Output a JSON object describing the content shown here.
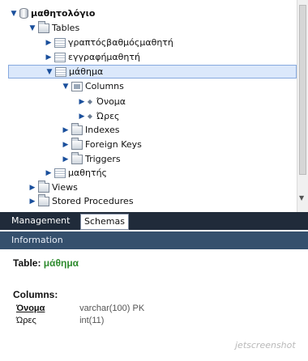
{
  "tree": {
    "database": "μαθητολόγιο",
    "tables_label": "Tables",
    "tables": [
      "γραπτόςβαθμόςμαθητή",
      "εγγραφήμαθητή",
      "μάθημα",
      "μαθητής"
    ],
    "selected_table": "μάθημα",
    "columns_label": "Columns",
    "columns": [
      "Όνομα",
      "Ώρες"
    ],
    "indexes_label": "Indexes",
    "foreign_keys_label": "Foreign Keys",
    "triggers_label": "Triggers",
    "views_label": "Views",
    "stored_procedures_label": "Stored Procedures"
  },
  "tabs": {
    "management": "Management",
    "schemas": "Schemas",
    "active": "Schemas"
  },
  "info": {
    "header": "Information",
    "table_label": "Table:",
    "table_name": "μάθημα",
    "columns_label": "Columns:",
    "columns": [
      {
        "name": "Όνομα",
        "type": "varchar(100) PK",
        "primary_key": true
      },
      {
        "name": "Ώρες",
        "type": "int(11)",
        "primary_key": false
      }
    ]
  },
  "watermark": "jetscreenshot",
  "icons": {
    "expanded": "triangle-down-icon",
    "collapsed": "triangle-right-icon",
    "database": "database-icon",
    "folder": "folder-icon",
    "table": "table-icon",
    "column": "diamond-icon"
  },
  "colors": {
    "tab_bar": "#202b3a",
    "info_bar": "#35506d",
    "selected_row": "#dbe8fb",
    "table_name": "#2e8b2e"
  }
}
